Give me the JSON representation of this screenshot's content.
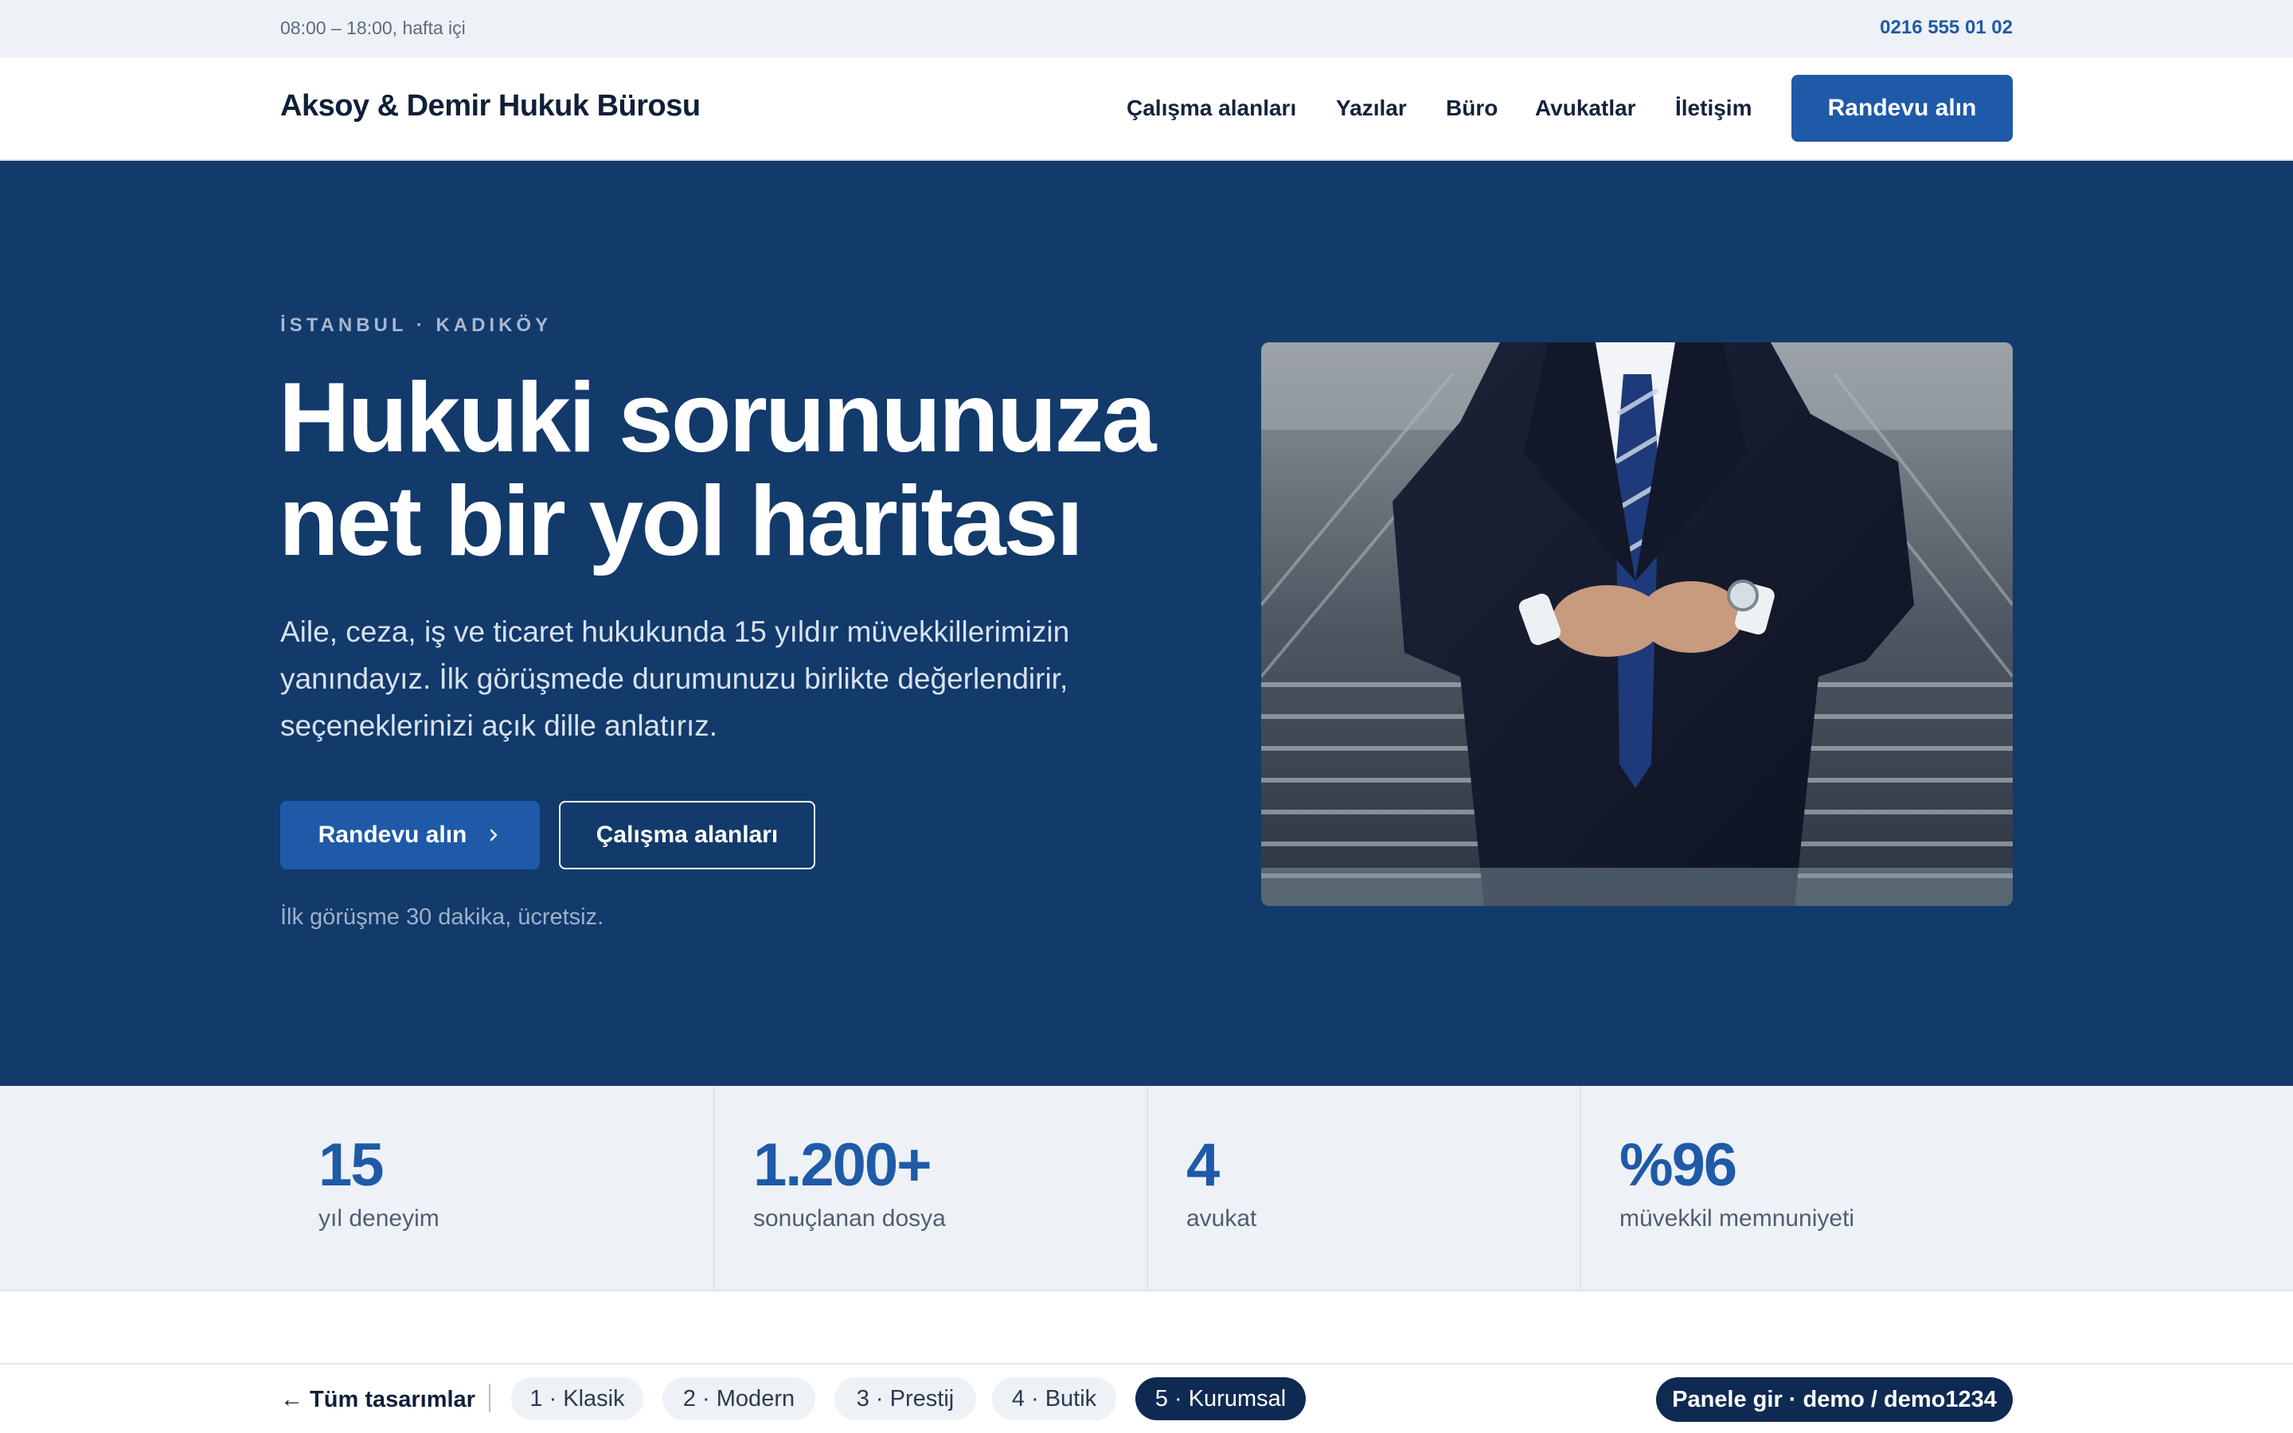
{
  "topbar": {
    "hours": "08:00 – 18:00, hafta içi",
    "phone": "0216 555 01 02"
  },
  "header": {
    "brand": "Aksoy & Demir Hukuk Bürosu",
    "nav": [
      "Çalışma alanları",
      "Yazılar",
      "Büro",
      "Avukatlar",
      "İletişim"
    ],
    "cta": "Randevu alın"
  },
  "hero": {
    "eyebrow": "İSTANBUL · KADIKÖY",
    "headline": [
      "Hukuki sorununuza",
      "net bir yol haritası"
    ],
    "lede": [
      "Aile, ceza, iş ve ticaret hukukunda 15 yıldır müvekkillerimizin",
      "yanındayız. İlk görüşmede durumunuzu birlikte değerlendirir,",
      "seçeneklerinizi açık dille anlatırız."
    ],
    "primary_button": "Randevu alın",
    "secondary_button": "Çalışma alanları",
    "note": "İlk görüşme 30 dakika, ücretsiz.",
    "photo_icon": "businessman-photo"
  },
  "stats": [
    {
      "value": "15",
      "label": "yıl deneyim"
    },
    {
      "value": "1.200+",
      "label": "sonuçlanan dosya"
    },
    {
      "value": "4",
      "label": "avukat"
    },
    {
      "value": "%96",
      "label": "müvekkil memnuniyeti"
    }
  ],
  "switcher": {
    "back": "← Tüm tasarımlar",
    "designs": [
      "1 · Klasik",
      "2 · Modern",
      "3 · Prestij",
      "4 · Butik",
      "5 · Kurumsal"
    ],
    "active": "5 · Kurumsal",
    "panel": "Panele gir · demo / demo1234"
  },
  "colors": {
    "primary": "#1e5aa8",
    "hero_bg": "#123a6b",
    "dark": "#0f2a52",
    "muted_bg": "#eef1f5"
  }
}
